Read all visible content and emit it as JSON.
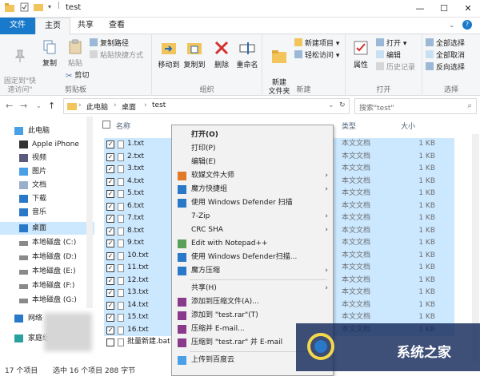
{
  "window": {
    "title": "test",
    "min": "—",
    "max": "☐",
    "close": "✕"
  },
  "ribbon_tabs": [
    {
      "label": "文件"
    },
    {
      "label": "主页"
    },
    {
      "label": "共享"
    },
    {
      "label": "查看"
    }
  ],
  "ribbon": {
    "clipboard": {
      "pin": "固定到\"快\n速访问\"",
      "copy": "复制",
      "paste": "粘贴",
      "copy_path": "复制路径",
      "paste_shortcut": "粘贴快捷方式",
      "cut": "剪切",
      "label": "剪贴板"
    },
    "organize": {
      "move_to": "移动到",
      "copy_to": "复制到",
      "delete": "删除",
      "rename": "重命名",
      "label": "组织"
    },
    "new": {
      "new_folder": "新建\n文件夹",
      "new_item": "新建项目 ▾",
      "easy_access": "轻松访问 ▾",
      "label": "新建"
    },
    "open": {
      "properties": "属性",
      "open": "打开 ▾",
      "edit": "编辑",
      "history": "历史记录",
      "label": "打开"
    },
    "select": {
      "select_all": "全部选择",
      "select_none": "全部取消",
      "invert": "反向选择",
      "label": "选择"
    }
  },
  "address": {
    "crumbs": [
      "此电脑",
      "桌面",
      "test"
    ],
    "search_placeholder": "搜索\"test\""
  },
  "nav": [
    {
      "label": "此电脑",
      "icon": "computer-icon"
    },
    {
      "label": "Apple iPhone",
      "icon": "phone-icon"
    },
    {
      "label": "视频",
      "icon": "video-icon"
    },
    {
      "label": "图片",
      "icon": "picture-icon"
    },
    {
      "label": "文档",
      "icon": "document-icon"
    },
    {
      "label": "下载",
      "icon": "download-icon"
    },
    {
      "label": "音乐",
      "icon": "music-icon"
    },
    {
      "label": "桌面",
      "icon": "desktop-icon"
    },
    {
      "label": "本地磁盘 (C:)",
      "icon": "drive-icon"
    },
    {
      "label": "本地磁盘 (D:)",
      "icon": "drive-icon"
    },
    {
      "label": "本地磁盘 (E:)",
      "icon": "drive-icon"
    },
    {
      "label": "本地磁盘 (F:)",
      "icon": "drive-icon"
    },
    {
      "label": "本地磁盘 (G:)",
      "icon": "drive-icon"
    },
    {
      "label": "网络",
      "icon": "network-icon"
    },
    {
      "label": "家庭组",
      "icon": "homegroup-icon"
    }
  ],
  "columns": {
    "name": "名称",
    "type": "类型",
    "size": "大小"
  },
  "files": [
    {
      "name": "1.txt",
      "type": "本文文档",
      "size": "1 KB",
      "selected": true
    },
    {
      "name": "2.txt",
      "type": "本文文档",
      "size": "1 KB",
      "selected": true
    },
    {
      "name": "3.txt",
      "type": "本文文档",
      "size": "1 KB",
      "selected": true
    },
    {
      "name": "4.txt",
      "type": "本文文档",
      "size": "1 KB",
      "selected": true
    },
    {
      "name": "5.txt",
      "type": "本文文档",
      "size": "1 KB",
      "selected": true
    },
    {
      "name": "6.txt",
      "type": "本文文档",
      "size": "1 KB",
      "selected": true
    },
    {
      "name": "7.txt",
      "type": "本文文档",
      "size": "1 KB",
      "selected": true
    },
    {
      "name": "8.txt",
      "type": "本文文档",
      "size": "1 KB",
      "selected": true
    },
    {
      "name": "9.txt",
      "type": "本文文档",
      "size": "1 KB",
      "selected": true
    },
    {
      "name": "10.txt",
      "type": "本文文档",
      "size": "1 KB",
      "selected": true
    },
    {
      "name": "11.txt",
      "type": "本文文档",
      "size": "1 KB",
      "selected": true
    },
    {
      "name": "12.txt",
      "type": "本文文档",
      "size": "1 KB",
      "selected": true
    },
    {
      "name": "13.txt",
      "type": "本文文档",
      "size": "1 KB",
      "selected": true
    },
    {
      "name": "14.txt",
      "type": "本文文档",
      "size": "1 KB",
      "selected": true
    },
    {
      "name": "15.txt",
      "type": "本文文档",
      "size": "1 KB",
      "selected": true
    },
    {
      "name": "16.txt",
      "type": "本文文档",
      "size": "1 KB",
      "selected": true
    },
    {
      "name": "批量新建.bat",
      "type": "",
      "size": "",
      "selected": false
    }
  ],
  "context_menu": [
    {
      "label": "打开(O)",
      "bold": true,
      "icon": "",
      "arrow": false,
      "sep_after": false
    },
    {
      "label": "打印(P)",
      "icon": "",
      "arrow": false,
      "sep_after": false
    },
    {
      "label": "编辑(E)",
      "icon": "",
      "arrow": false,
      "sep_after": false
    },
    {
      "label": "软媒文件大师",
      "icon": "filemaster-icon",
      "arrow": true,
      "sep_after": false
    },
    {
      "label": "魔方快捷组",
      "icon": "cube-icon",
      "arrow": true,
      "sep_after": false
    },
    {
      "label": "使用 Windows Defender 扫描",
      "icon": "defender-icon",
      "arrow": false,
      "sep_after": false
    },
    {
      "label": "7-Zip",
      "icon": "",
      "arrow": true,
      "sep_after": false
    },
    {
      "label": "CRC SHA",
      "icon": "",
      "arrow": true,
      "sep_after": false
    },
    {
      "label": "Edit with Notepad++",
      "icon": "notepad-icon",
      "arrow": false,
      "sep_after": false
    },
    {
      "label": "使用 Windows Defender扫描...",
      "icon": "defender-icon",
      "arrow": false,
      "sep_after": false
    },
    {
      "label": "魔方压缩",
      "icon": "cube-icon",
      "arrow": true,
      "sep_after": true
    },
    {
      "label": "共享(H)",
      "icon": "",
      "arrow": true,
      "sep_after": false
    },
    {
      "label": "添加到压缩文件(A)...",
      "icon": "rar-icon",
      "arrow": false,
      "sep_after": false
    },
    {
      "label": "添加到 \"test.rar\"(T)",
      "icon": "rar-icon",
      "arrow": false,
      "sep_after": false
    },
    {
      "label": "压缩并 E-mail...",
      "icon": "rar-icon",
      "arrow": false,
      "sep_after": false
    },
    {
      "label": "压缩到 \"test.rar\" 并 E-mail",
      "icon": "rar-icon",
      "arrow": false,
      "sep_after": true
    },
    {
      "label": "上传到百度云",
      "icon": "cloud-icon",
      "arrow": false,
      "sep_after": false
    }
  ],
  "status": {
    "count": "17 个项目",
    "selected": "选中 16 个项目 288 字节"
  },
  "watermark": {
    "text": "系统之家"
  },
  "colors": {
    "accent": "#1979ca",
    "selection": "#cce8ff",
    "menu_bg": "#f2f2f2"
  }
}
